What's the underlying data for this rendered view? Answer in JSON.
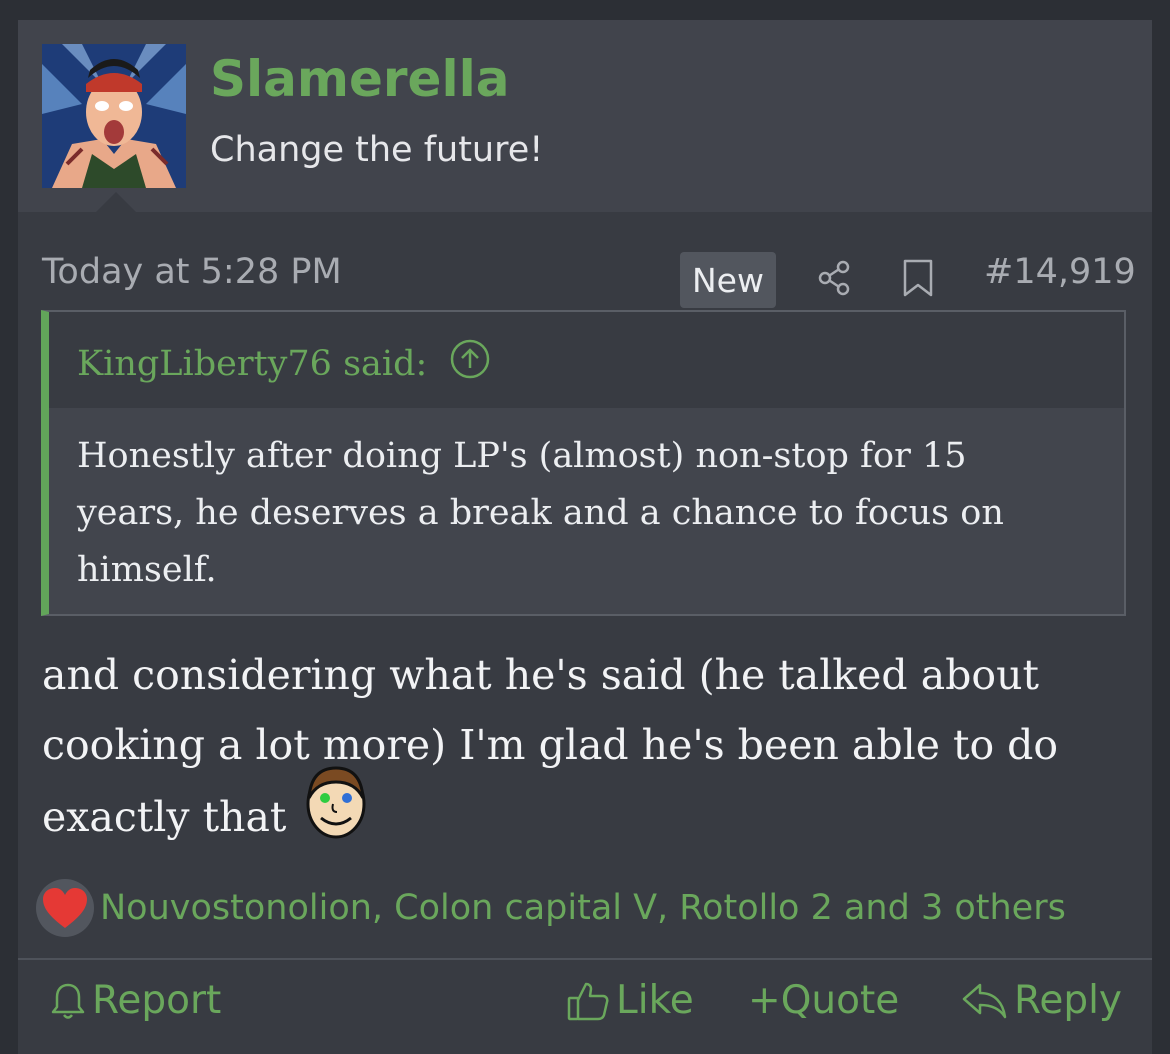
{
  "post": {
    "username": "Slamerella",
    "user_title": "Change the future!",
    "date": "Today at 5:28 PM",
    "new_badge": "New",
    "post_number": "#14,919"
  },
  "quote": {
    "author": "KingLiberty76 said:",
    "text": "Honestly after doing LP's (almost) non-stop for 15 years, he deserves a break and a chance to focus on himself."
  },
  "message": {
    "text": "and considering what he's said (he talked about cooking a lot more) I'm glad he's been able to do exactly that"
  },
  "reactions": {
    "icon": "heart-icon",
    "users": "Nouvostonolion, Colon capital V, Rotollo 2 and 3 others"
  },
  "actions": {
    "report": "Report",
    "like": "Like",
    "quote": "Quote",
    "quote_prefix": "+",
    "reply": "Reply"
  },
  "colors": {
    "accent_green": "#6aa75c",
    "background": "#383b42",
    "header_bg": "#41444c"
  }
}
